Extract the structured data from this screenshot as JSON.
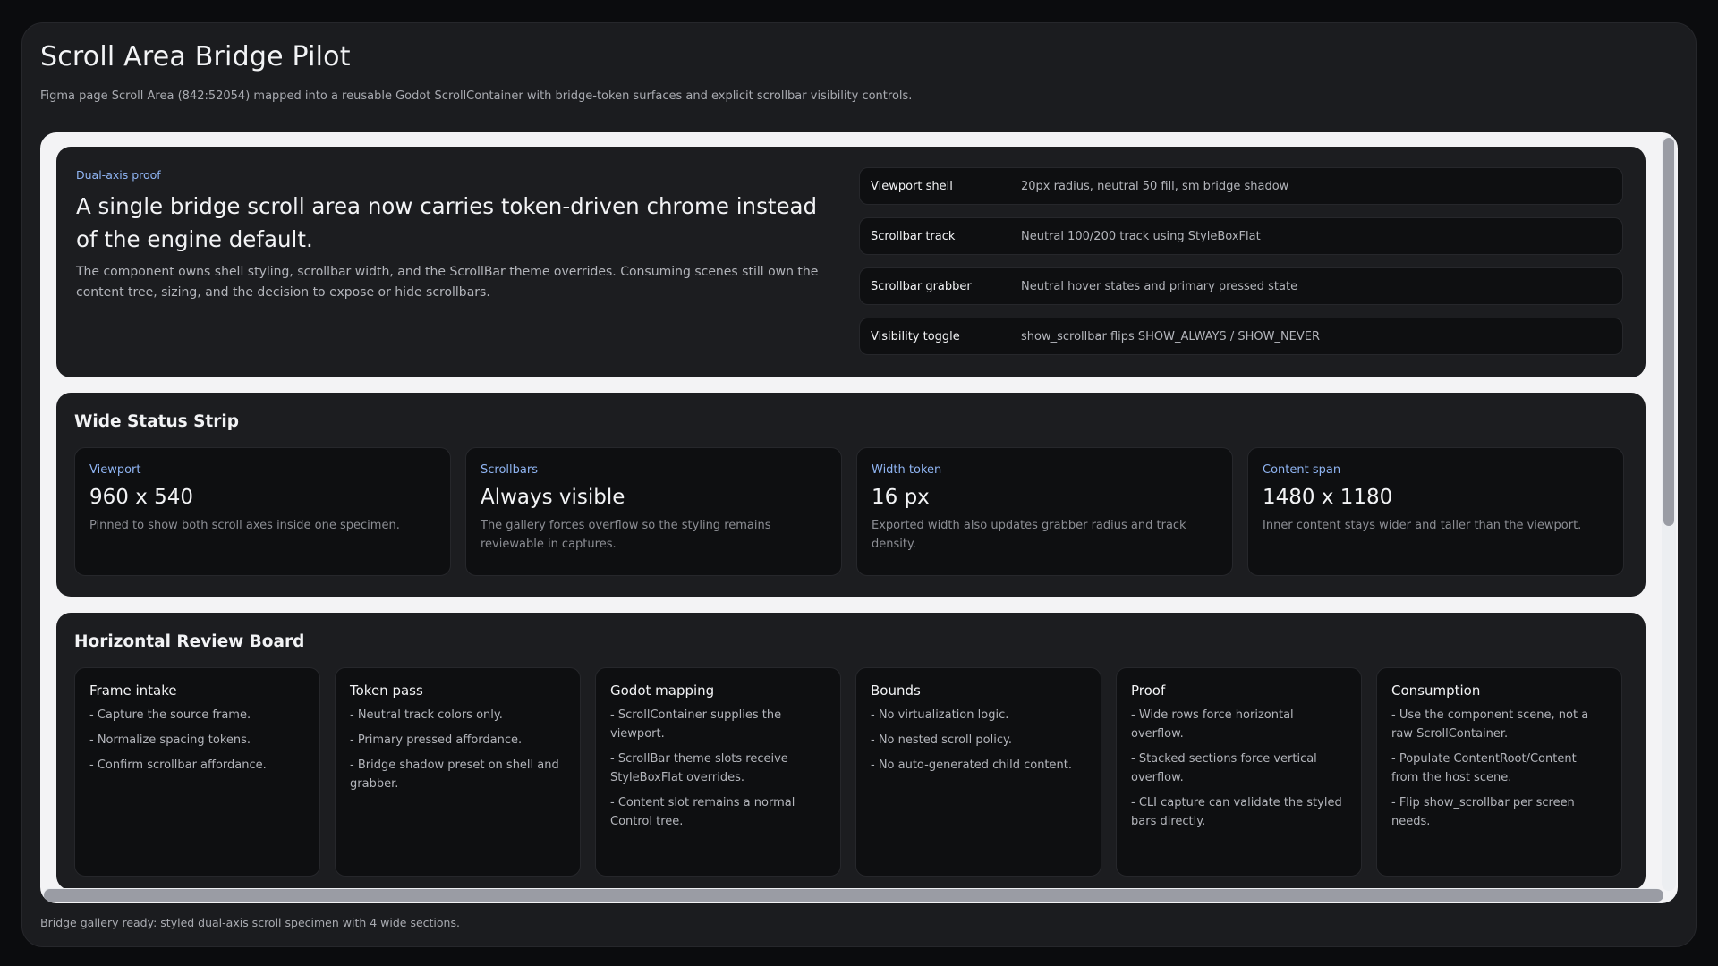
{
  "app": {
    "title": "Scroll Area Bridge Pilot",
    "subtitle": "Figma page Scroll Area (842:52054) mapped into a reusable Godot ScrollContainer with bridge-token surfaces and explicit scrollbar visibility controls.",
    "status": "Bridge gallery ready: styled dual-axis scroll specimen with 4 wide sections."
  },
  "hero": {
    "eyebrow": "Dual-axis proof",
    "title": "A single bridge scroll area now carries token-driven chrome instead of the engine default.",
    "body": "The component owns shell styling, scrollbar width, and the ScrollBar theme overrides. Consuming scenes still own the content tree, sizing, and the decision to expose or hide scrollbars.",
    "specs": [
      {
        "key": "Viewport shell",
        "value": "20px radius, neutral 50 fill, sm bridge shadow"
      },
      {
        "key": "Scrollbar track",
        "value": "Neutral 100/200 track using StyleBoxFlat"
      },
      {
        "key": "Scrollbar grabber",
        "value": "Neutral hover states and primary pressed state"
      },
      {
        "key": "Visibility toggle",
        "value": "show_scrollbar flips SHOW_ALWAYS / SHOW_NEVER"
      }
    ]
  },
  "status_strip": {
    "title": "Wide Status Strip",
    "cards": [
      {
        "label": "Viewport",
        "value": "960 x 540",
        "desc": "Pinned to show both scroll axes inside one specimen."
      },
      {
        "label": "Scrollbars",
        "value": "Always visible",
        "desc": "The gallery forces overflow so the styling remains reviewable in captures."
      },
      {
        "label": "Width token",
        "value": "16 px",
        "desc": "Exported width also updates grabber radius and track density."
      },
      {
        "label": "Content span",
        "value": "1480 x 1180",
        "desc": "Inner content stays wider and taller than the viewport."
      }
    ]
  },
  "review_board": {
    "title": "Horizontal Review Board",
    "cards": [
      {
        "title": "Frame intake",
        "items": [
          "- Capture the source frame.",
          "- Normalize spacing tokens.",
          "- Confirm scrollbar affordance."
        ]
      },
      {
        "title": "Token pass",
        "items": [
          "- Neutral track colors only.",
          "- Primary pressed affordance.",
          "- Bridge shadow preset on shell and grabber."
        ]
      },
      {
        "title": "Godot mapping",
        "items": [
          "- ScrollContainer supplies the viewport.",
          "- ScrollBar theme slots receive StyleBoxFlat overrides.",
          "- Content slot remains a normal Control tree."
        ]
      },
      {
        "title": "Bounds",
        "items": [
          "- No virtualization logic.",
          "- No nested scroll policy.",
          "- No auto-generated child content."
        ]
      },
      {
        "title": "Proof",
        "items": [
          "- Wide rows force horizontal overflow.",
          "- Stacked sections force vertical overflow.",
          "- CLI capture can validate the styled bars directly."
        ]
      },
      {
        "title": "Consumption",
        "items": [
          "- Use the component scene, not a raw ScrollContainer.",
          "- Populate ContentRoot/Content from the host scene.",
          "- Flip show_scrollbar per screen needs."
        ]
      }
    ]
  },
  "scrollbars": {
    "vertical_position": 0.0,
    "horizontal_position": 0.0
  }
}
